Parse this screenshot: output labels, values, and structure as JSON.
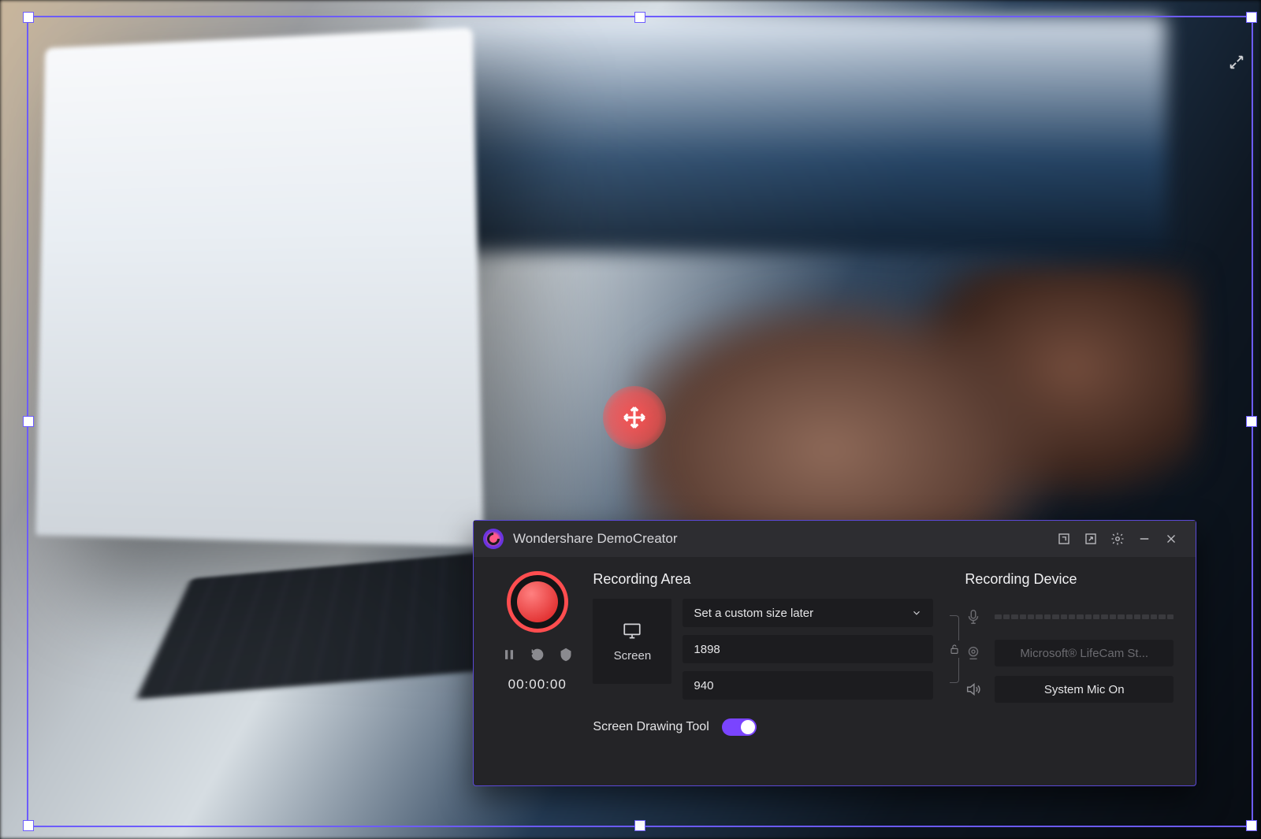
{
  "panel": {
    "title": "Wondershare DemoCreator",
    "recording_area_title": "Recording Area",
    "recording_device_title": "Recording Device",
    "screen_label": "Screen",
    "size_selector": "Set a custom size later",
    "width_value": "1898",
    "height_value": "940",
    "drawing_tool_label": "Screen Drawing Tool",
    "timer": "00:00:00",
    "webcam_label": "Microsoft® LifeCam St...",
    "system_audio_label": "System Mic On"
  }
}
